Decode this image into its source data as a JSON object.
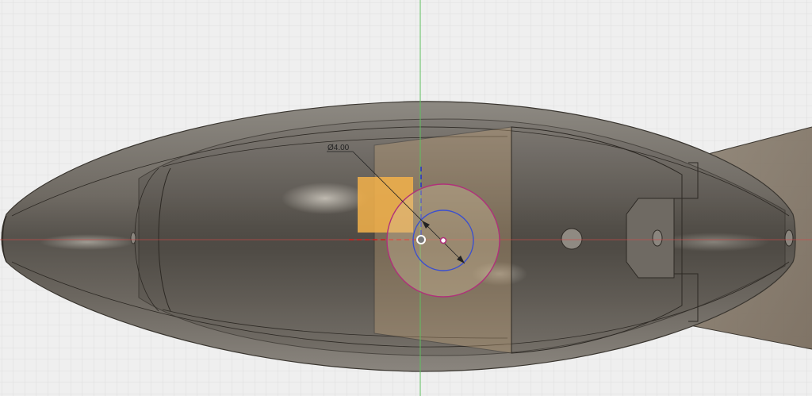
{
  "viewport": {
    "background": "#efefef",
    "grid_color_minor": "#dadada",
    "grid_color_major": "#c8c8c8",
    "y_axis_color": "#5fbf5f",
    "x_axis_color": "#d94848"
  },
  "sketch": {
    "dimension_label": "Ø4.00",
    "sketch_circle_color": "#b0307a",
    "profile_circle_color": "#3a4fd0",
    "selected_face_color": "#f3b24a"
  }
}
